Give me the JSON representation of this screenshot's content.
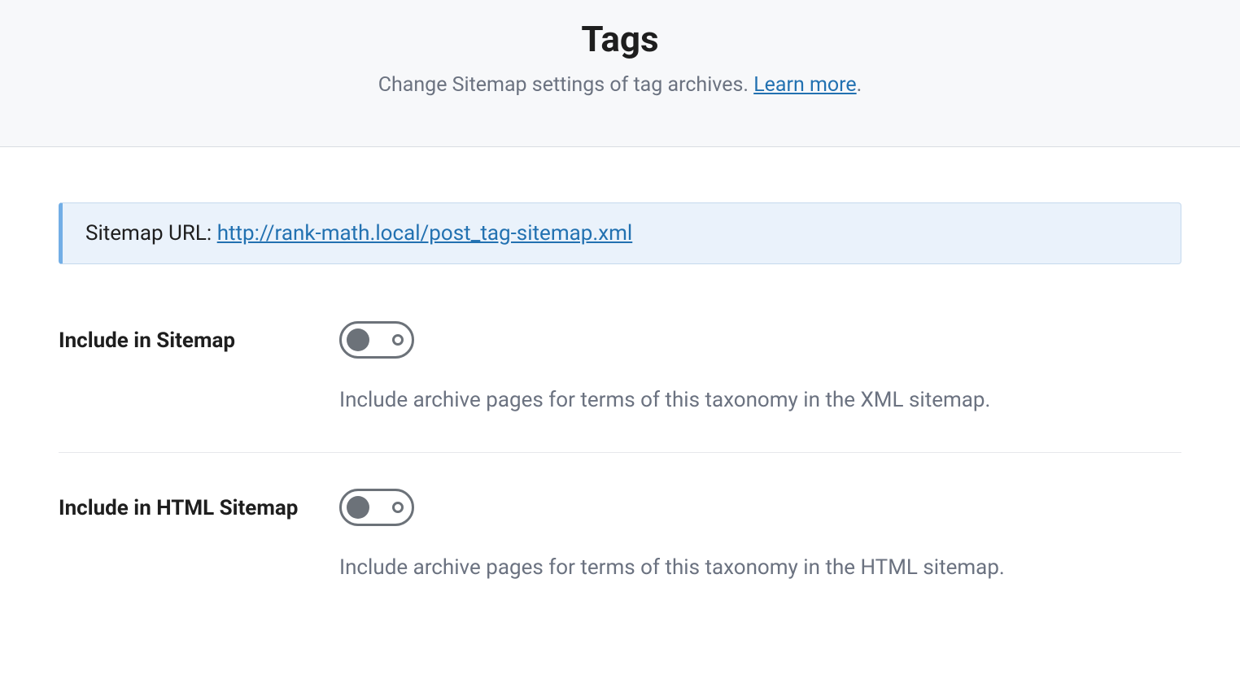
{
  "header": {
    "title": "Tags",
    "subtitle_text": "Change Sitemap settings of tag archives. ",
    "subtitle_link": "Learn more",
    "subtitle_after": "."
  },
  "notice": {
    "label": "Sitemap URL: ",
    "url": "http://rank-math.local/post_tag-sitemap.xml"
  },
  "settings": [
    {
      "label": "Include in Sitemap",
      "enabled": false,
      "description": "Include archive pages for terms of this taxonomy in the XML sitemap."
    },
    {
      "label": "Include in HTML Sitemap",
      "enabled": false,
      "description": "Include archive pages for terms of this taxonomy in the HTML sitemap."
    }
  ]
}
